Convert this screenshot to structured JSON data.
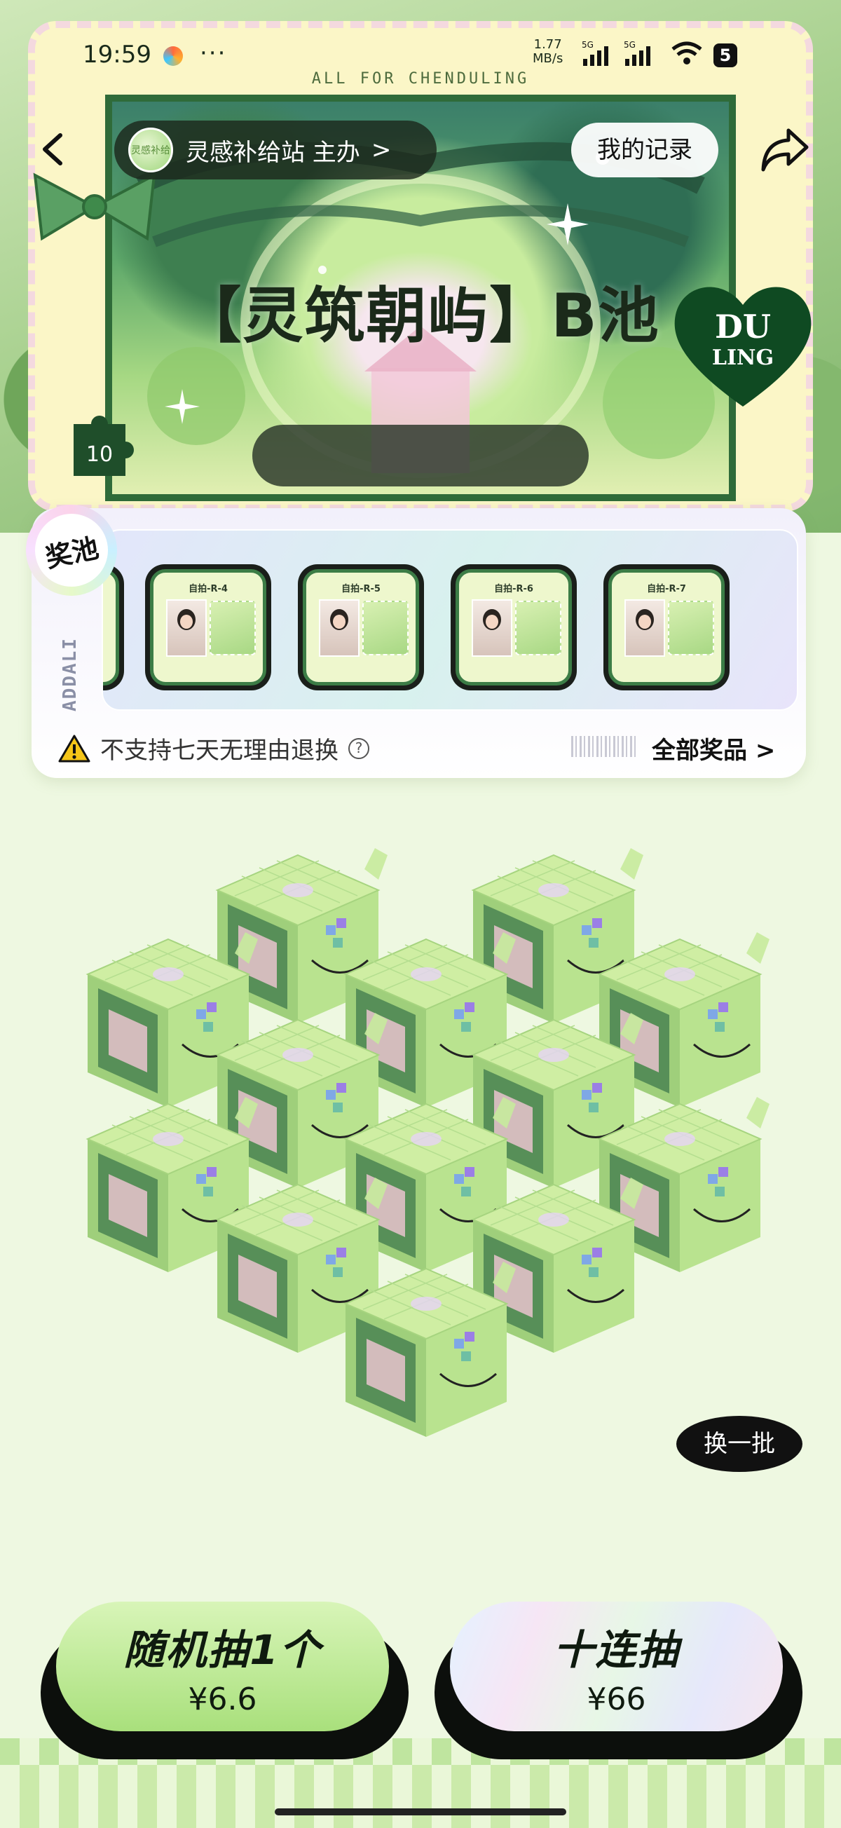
{
  "status_bar": {
    "time": "19:59",
    "more": "···",
    "net_speed_value": "1.77",
    "net_speed_unit": "MB/s",
    "signal_1_label": "5G",
    "signal_2_label": "5G",
    "battery_level": "5"
  },
  "header": {
    "frame_caption": "ALL FOR CHENDULING",
    "host_label": "灵感补给站 主办",
    "host_chevron": ">",
    "host_avatar_text": "灵感补给",
    "records_label": "我的记录",
    "pool_title": "【灵筑朝屿】B池",
    "heart_logo_text_1": "DU",
    "heart_logo_text_2": "LING",
    "puzzle_number": "10"
  },
  "prize_pool": {
    "badge_label": "奖池",
    "vertical_brand": "ADDALI",
    "cards": [
      {
        "label": "自拍-R-4"
      },
      {
        "label": "自拍-R-5"
      },
      {
        "label": "自拍-R-6"
      },
      {
        "label": "自拍-R-7"
      }
    ],
    "warning_text": "不支持七天无理由退换",
    "help_symbol": "?",
    "all_prizes_label": "全部奖品 >"
  },
  "boxes": {
    "count": 13,
    "swap_batch_label": "换一批"
  },
  "actions": {
    "single_draw_label": "随机抽1个",
    "single_draw_price": "¥6.6",
    "ten_draw_label": "十连抽",
    "ten_draw_price": "¥66"
  },
  "colors": {
    "accent_green": "#b7e58f",
    "dark_green": "#2f6b39",
    "page_bg": "#eef8e1",
    "pill_dark": "#1c281c"
  }
}
